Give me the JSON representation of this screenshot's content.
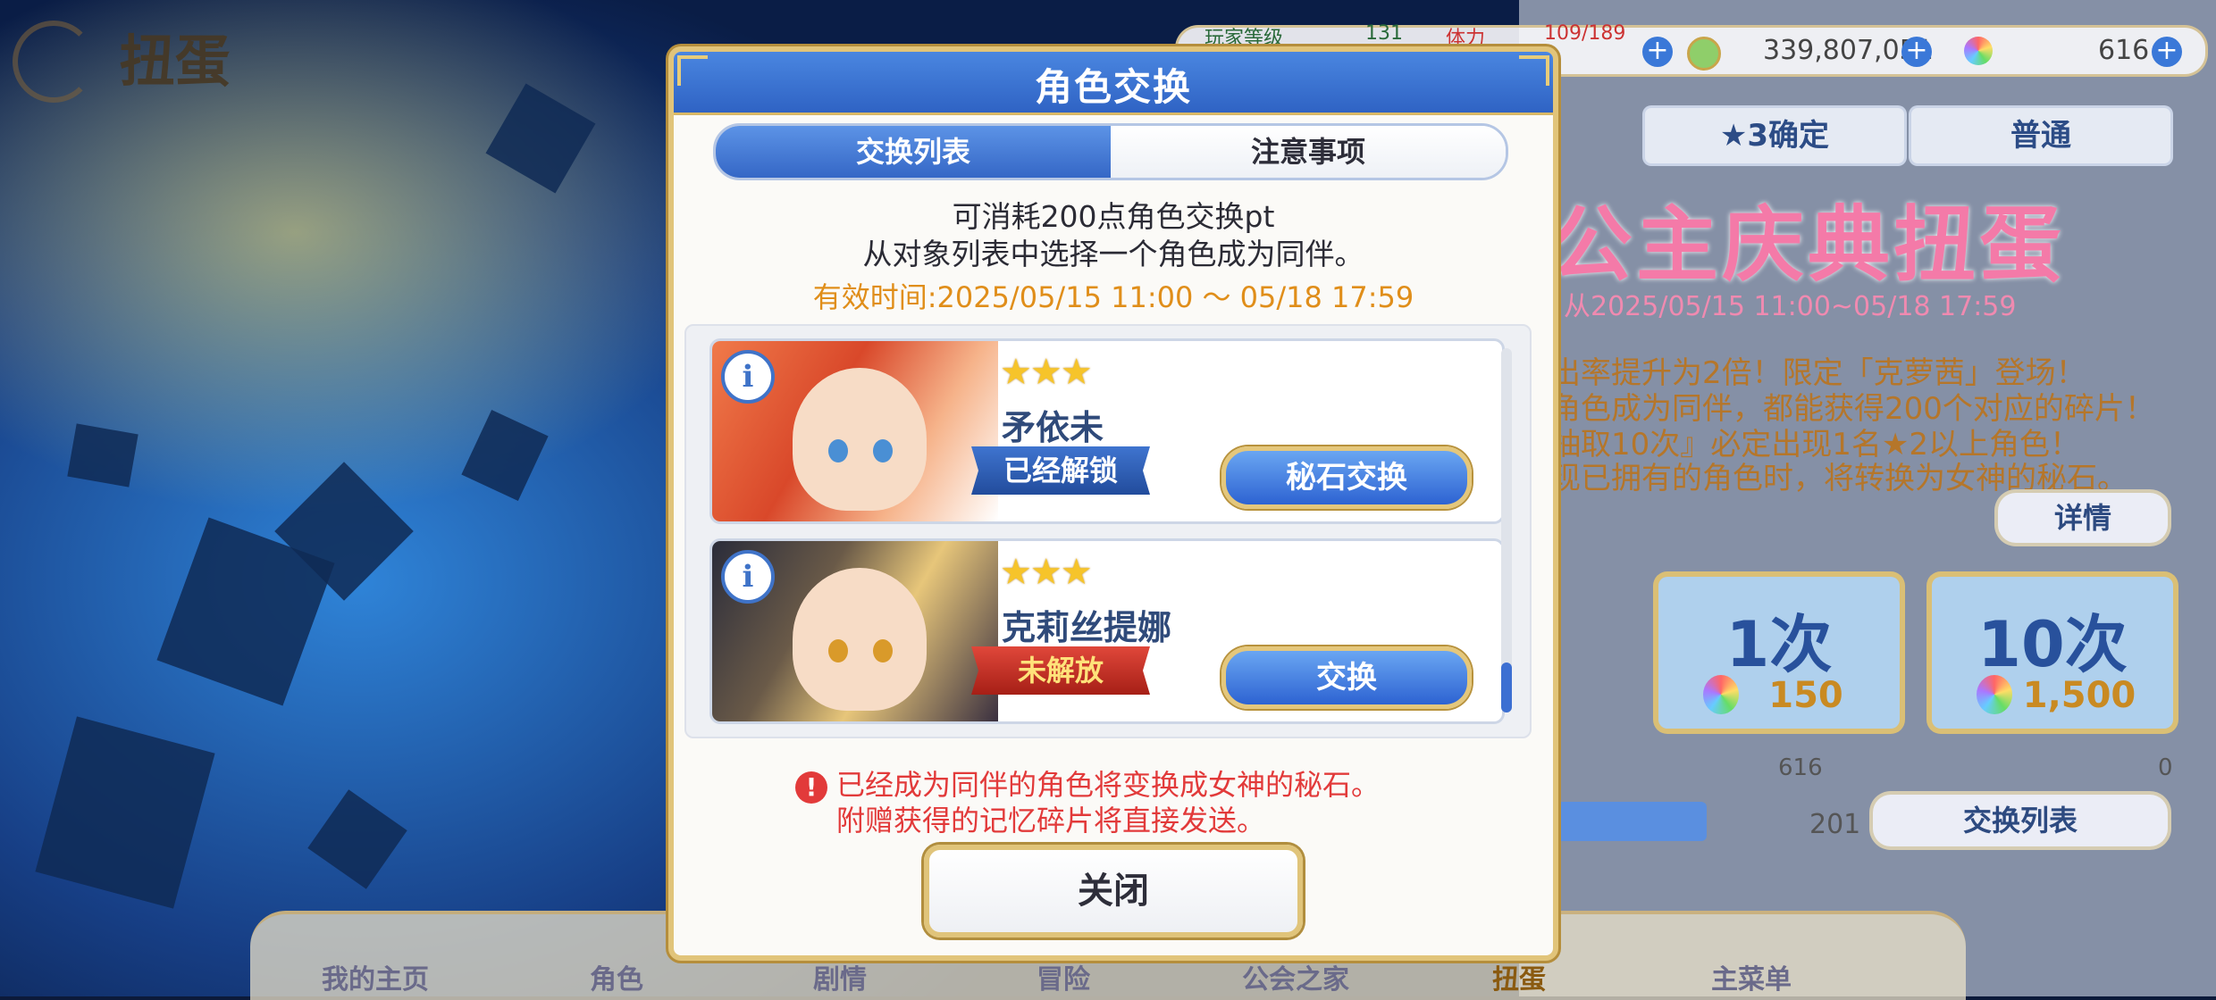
{
  "background": {
    "logo_text": "扭蛋",
    "status_bar": {
      "player_level_label": "玩家等级",
      "player_level": "131",
      "stamina_label": "体力",
      "stamina": "109/189",
      "mana": "339,807,051",
      "gems": "616"
    },
    "tabs": [
      "★3确定",
      "普通"
    ],
    "banner_title": "公主庆典扭蛋",
    "banner_date": "从2025/05/15 11:00~05/18 17:59",
    "description": [
      "出率提升为2倍！限定「克萝茜」登场！",
      "角色成为同伴，都能获得200个对应的碎片！",
      "抽取10次』必定出现1名★2以上角色！",
      "现已拥有的角色时，将转换为女神的秘石。"
    ],
    "details_button": "详情",
    "draw_buttons": [
      {
        "count": "1次",
        "cost": "150"
      },
      {
        "count": "10次",
        "cost": "1,500"
      }
    ],
    "pt_value": "201",
    "gem_count": "616",
    "free_gem_count": "0",
    "exchange_list_button": "交换列表",
    "nav": [
      "我的主页",
      "角色",
      "剧情",
      "冒险",
      "公会之家",
      "扭蛋",
      "主菜单"
    ]
  },
  "modal": {
    "title": "角色交换",
    "tabs": {
      "list": "交换列表",
      "notes": "注意事项"
    },
    "info_line1": "可消耗200点角色交换pt",
    "info_line2": "从对象列表中选择一个角色成为同伴。",
    "validity": "有效时间:2025/05/15  11:00 ～ 05/18  17:59",
    "characters": [
      {
        "stars": "★★★",
        "name": "矛依未",
        "status": "已经解锁",
        "action": "秘石交换",
        "status_color": "#2f5fb8"
      },
      {
        "stars": "★★★",
        "name": "克莉丝提娜",
        "status": "未解放",
        "action": "交换",
        "status_color": "#c93024"
      }
    ],
    "info_icon": "i",
    "warning_icon": "!",
    "warning_line1": "已经成为同伴的角色将变换成女神的秘石。",
    "warning_line2": "附赠获得的记忆碎片将直接发送。",
    "close_button": "关闭"
  },
  "colors": {
    "accent_blue": "#3567c6",
    "gold_border": "#e1c47a",
    "warning_red": "#e23a3a",
    "validity_orange": "#e08e1a"
  }
}
